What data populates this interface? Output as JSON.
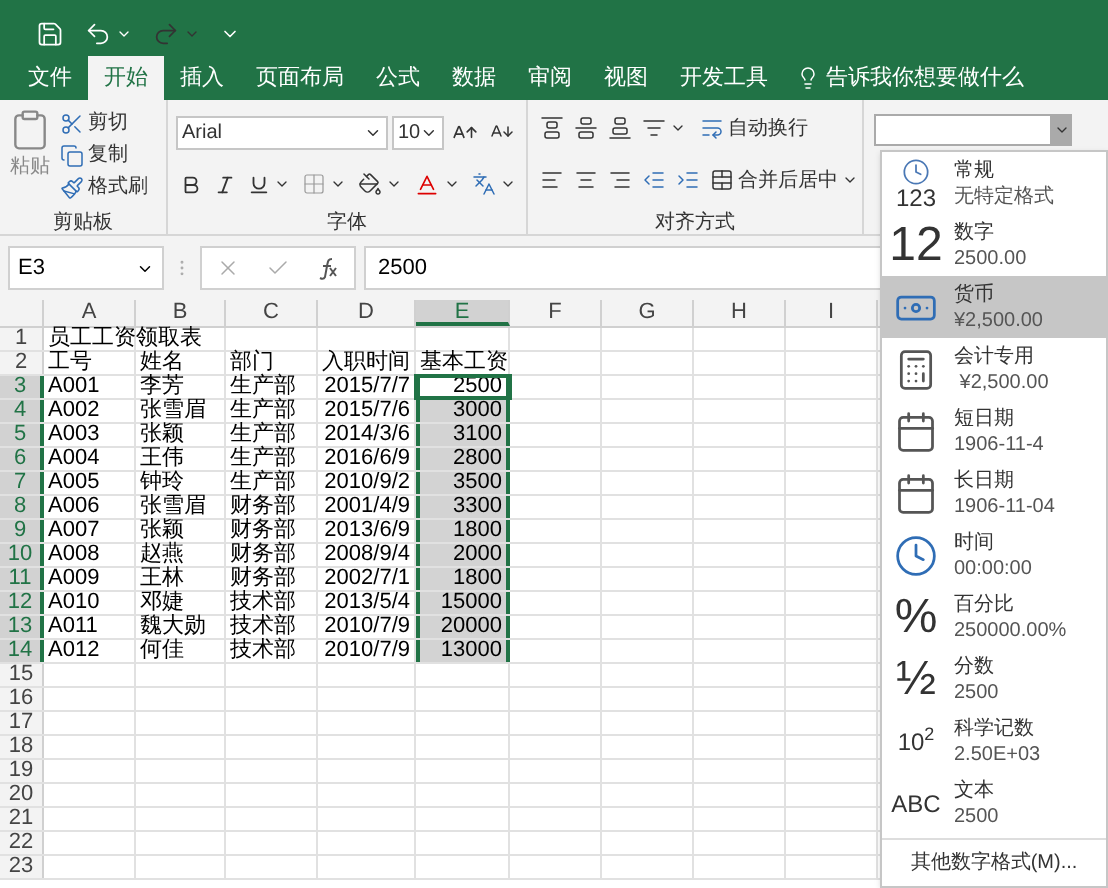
{
  "tabs": [
    {
      "label": "文件",
      "selected": false
    },
    {
      "label": "开始",
      "selected": true
    },
    {
      "label": "插入",
      "selected": false
    },
    {
      "label": "页面布局",
      "selected": false
    },
    {
      "label": "公式",
      "selected": false
    },
    {
      "label": "数据",
      "selected": false
    },
    {
      "label": "审阅",
      "selected": false
    },
    {
      "label": "视图",
      "selected": false
    },
    {
      "label": "开发工具",
      "selected": false
    }
  ],
  "tell_me": "告诉我你想要做什么",
  "clipboard": {
    "paste": "粘贴",
    "buttons": [
      "剪切",
      "复制",
      "格式刷"
    ],
    "label": "剪贴板"
  },
  "font": {
    "name": "Arial",
    "size": "10",
    "label": "字体"
  },
  "alignment": {
    "wrap": "自动换行",
    "merge": "合并后居中",
    "label": "对齐方式"
  },
  "formula_bar": {
    "name_box": "E3",
    "formula": "2500"
  },
  "sheet": {
    "columns": [
      {
        "label": "A",
        "selected": false
      },
      {
        "label": "B",
        "selected": false
      },
      {
        "label": "C",
        "selected": false
      },
      {
        "label": "D",
        "selected": false
      },
      {
        "label": "E",
        "selected": true
      },
      {
        "label": "F",
        "selected": false
      },
      {
        "label": "G",
        "selected": false
      },
      {
        "label": "H",
        "selected": false
      },
      {
        "label": "I",
        "selected": false
      }
    ],
    "rows": [
      {
        "header": "1",
        "kind": "title",
        "selected": false,
        "active": false,
        "cells": [
          "员工工资领取表"
        ]
      },
      {
        "header": "2",
        "kind": "header",
        "selected": false,
        "active": false,
        "cells": [
          "工号",
          "姓名",
          "部门",
          "入职时间",
          "基本工资"
        ]
      },
      {
        "header": "3",
        "kind": "data",
        "selected": true,
        "active": true,
        "cells": [
          "A001",
          "李芳",
          "生产部",
          "2015/7/7",
          "2500"
        ]
      },
      {
        "header": "4",
        "kind": "data",
        "selected": true,
        "active": false,
        "cells": [
          "A002",
          "张雪眉",
          "生产部",
          "2015/7/6",
          "3000"
        ]
      },
      {
        "header": "5",
        "kind": "data",
        "selected": true,
        "active": false,
        "cells": [
          "A003",
          "张颖",
          "生产部",
          "2014/3/6",
          "3100"
        ]
      },
      {
        "header": "6",
        "kind": "data",
        "selected": true,
        "active": false,
        "cells": [
          "A004",
          "王伟",
          "生产部",
          "2016/6/9",
          "2800"
        ]
      },
      {
        "header": "7",
        "kind": "data",
        "selected": true,
        "active": false,
        "cells": [
          "A005",
          "钟玲",
          "生产部",
          "2010/9/2",
          "3500"
        ]
      },
      {
        "header": "8",
        "kind": "data",
        "selected": true,
        "active": false,
        "cells": [
          "A006",
          "张雪眉",
          "财务部",
          "2001/4/9",
          "3300"
        ]
      },
      {
        "header": "9",
        "kind": "data",
        "selected": true,
        "active": false,
        "cells": [
          "A007",
          "张颖",
          "财务部",
          "2013/6/9",
          "1800"
        ]
      },
      {
        "header": "10",
        "kind": "data",
        "selected": true,
        "active": false,
        "cells": [
          "A008",
          "赵燕",
          "财务部",
          "2008/9/4",
          "2000"
        ]
      },
      {
        "header": "11",
        "kind": "data",
        "selected": true,
        "active": false,
        "cells": [
          "A009",
          "王林",
          "财务部",
          "2002/7/1",
          "1800"
        ]
      },
      {
        "header": "12",
        "kind": "data",
        "selected": true,
        "active": false,
        "cells": [
          "A010",
          "邓婕",
          "技术部",
          "2013/5/4",
          "15000"
        ]
      },
      {
        "header": "13",
        "kind": "data",
        "selected": true,
        "active": false,
        "cells": [
          "A011",
          "魏大勋",
          "技术部",
          "2010/7/9",
          "20000"
        ]
      },
      {
        "header": "14",
        "kind": "data",
        "selected": true,
        "active": false,
        "cells": [
          "A012",
          "何佳",
          "技术部",
          "2010/7/9",
          "13000"
        ]
      },
      {
        "header": "15",
        "kind": "data",
        "selected": false,
        "active": false
      },
      {
        "header": "16",
        "kind": "data",
        "selected": false,
        "active": false
      },
      {
        "header": "17",
        "kind": "data",
        "selected": false,
        "active": false
      },
      {
        "header": "18",
        "kind": "data",
        "selected": false,
        "active": false
      },
      {
        "header": "19",
        "kind": "data",
        "selected": false,
        "active": false
      },
      {
        "header": "20",
        "kind": "data",
        "selected": false,
        "active": false
      },
      {
        "header": "21",
        "kind": "data",
        "selected": false,
        "active": false
      },
      {
        "header": "22",
        "kind": "data",
        "selected": false,
        "active": false
      },
      {
        "header": "23",
        "kind": "data",
        "selected": false,
        "active": false
      }
    ]
  },
  "number_formats": {
    "items": [
      {
        "kind": "general",
        "icon": "123",
        "name": "常规",
        "example": "无特定格式",
        "selected": false
      },
      {
        "kind": "number",
        "icon": "12",
        "name": "数字",
        "example": "2500.00",
        "selected": false
      },
      {
        "kind": "currency",
        "name": "货币",
        "example": "¥2,500.00",
        "selected": true
      },
      {
        "kind": "accounting",
        "name": "会计专用",
        "example": " ¥2,500.00",
        "selected": false
      },
      {
        "kind": "short_date",
        "name": "短日期",
        "example": "1906-11-4",
        "selected": false
      },
      {
        "kind": "long_date",
        "name": "长日期",
        "example": "1906-11-04",
        "selected": false
      },
      {
        "kind": "time",
        "name": "时间",
        "example": "00:00:00",
        "selected": false
      },
      {
        "kind": "percent",
        "icon": "%",
        "name": "百分比",
        "example": "250000.00%",
        "selected": false
      },
      {
        "kind": "fraction",
        "icon": "½",
        "name": "分数",
        "example": "2500",
        "selected": false
      },
      {
        "kind": "scientific",
        "icon": "10$^{2}$",
        "name": "科学记数",
        "example": "2.50E+03",
        "selected": false
      },
      {
        "kind": "text",
        "icon": "ABC",
        "name": "文本",
        "example": "2500",
        "selected": false
      }
    ],
    "more": "其他数字格式(M)..."
  }
}
